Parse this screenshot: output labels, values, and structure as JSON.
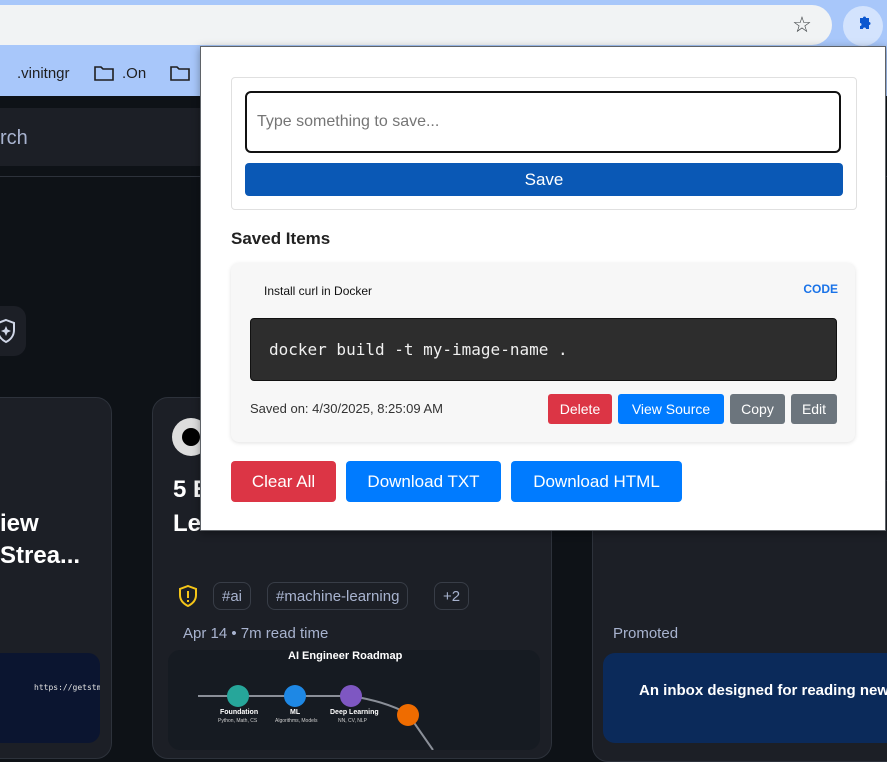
{
  "browser": {
    "bookmarks": [
      ".vinitngr",
      ".On",
      ""
    ],
    "icons": [
      "star-icon",
      "puzzle-icon",
      "folder-icon"
    ]
  },
  "site": {
    "search_partial": "rch",
    "card_left": {
      "title_line1": "iew",
      "title_line2": "Strea..."
    },
    "card_mid": {
      "title_line1": "5 E",
      "title_line2": "Le",
      "tags": [
        "#ai",
        "#machine-learning",
        "+2"
      ],
      "meta": "Apr 14 • 7m read time",
      "thumb_title": "AI Engineer Roadmap",
      "roadmap_nodes": [
        {
          "label": "Foundation",
          "sub": "Python, Math, CS"
        },
        {
          "label": "ML",
          "sub": "Algorithms, Models"
        },
        {
          "label": "Deep Learning",
          "sub": "NN, CV, NLP"
        }
      ]
    },
    "card_right": {
      "promoted": "Promoted",
      "ad_text": "An inbox designed for reading new"
    },
    "left_thumb_url": "https://getstm"
  },
  "popup": {
    "input_placeholder": "Type something to save...",
    "input_value": "",
    "save_label": "Save",
    "saved_heading": "Saved Items",
    "items": [
      {
        "title": "Install curl in Docker",
        "type": "CODE",
        "content": "docker build -t my-image-name .",
        "saved_on": "Saved on: 4/30/2025, 8:25:09 AM",
        "actions": {
          "delete": "Delete",
          "view_source": "View Source",
          "copy": "Copy",
          "edit": "Edit"
        }
      }
    ],
    "clear_all": "Clear All",
    "download_txt": "Download TXT",
    "download_html": "Download HTML"
  },
  "colors": {
    "save_blue": "#0a58b5",
    "danger_red": "#dc3545",
    "primary_blue": "#007bff",
    "gray": "#6c757d",
    "type_blue": "#1a73e8",
    "chrome_blue": "#a8c7fa",
    "site_dark": "#0e1217"
  }
}
